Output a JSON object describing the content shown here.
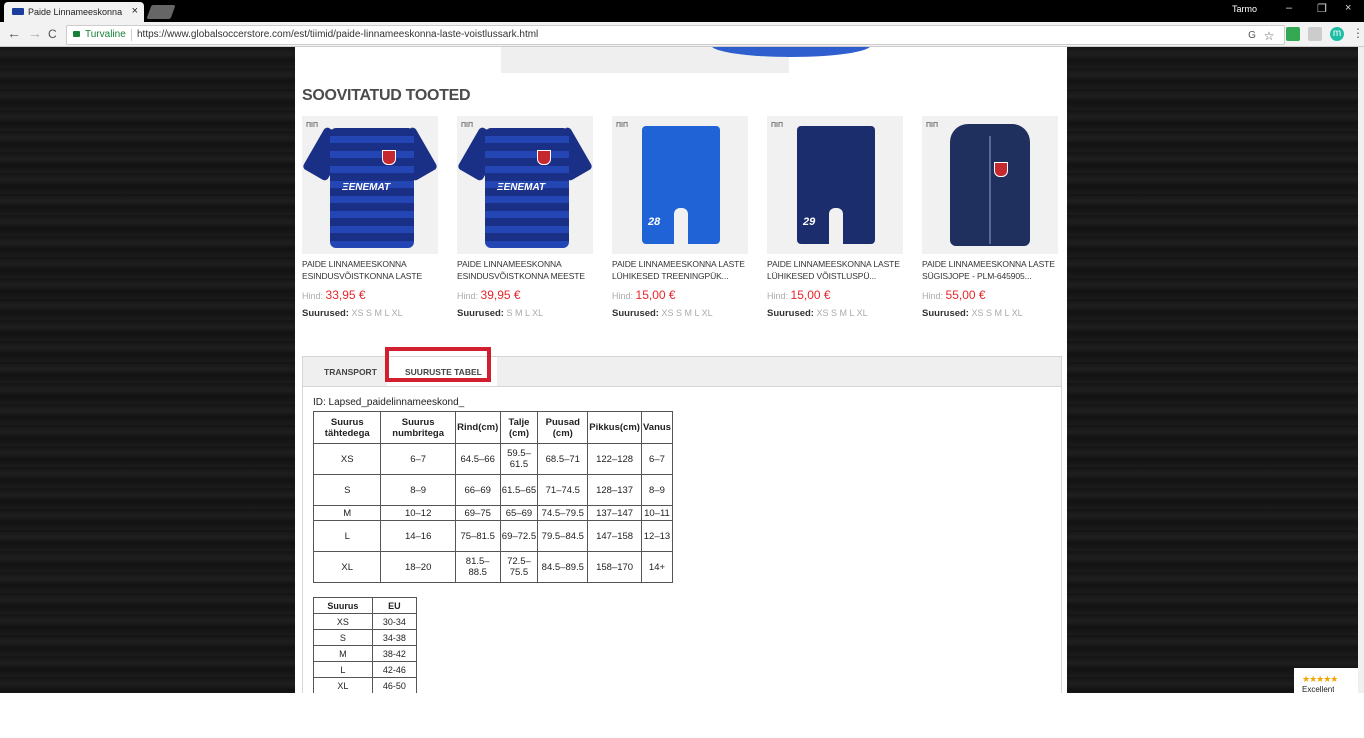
{
  "browser": {
    "tab_title": "Paide Linnameeskonna laste võistlussärk",
    "close_glyph": "×",
    "user_name": "Tarmo",
    "secure_label": "Turvaline",
    "url": "https://www.globalsoccerstore.com/est/tiimid/paide-linnameeskonna-laste-voistlussark.html",
    "back_glyph": "←",
    "forward_glyph": "→",
    "reload_glyph": "C",
    "minimize_glyph": "–",
    "restore_glyph": "❐",
    "close_window_glyph": "×",
    "star_glyph": "☆",
    "menu_glyph": "⋮",
    "translate_glyph": "G",
    "extension_glyph": "m"
  },
  "recommended": {
    "title": "SOOVITATUD TOOTED",
    "price_label": "Hind:",
    "sizes_label": "Suurused:",
    "items": [
      {
        "name": "PAIDE LINNAMEESKONNA ESINDUSVÕISTKONNA LASTE FÄN...",
        "price": "33,95 €",
        "sizes": "XS S M L XL",
        "badge": "ΠΙΠ",
        "image": "jersey"
      },
      {
        "name": "PAIDE LINNAMEESKONNA ESINDUSVÕISTKONNA MEESTE FÄ...",
        "price": "39,95 €",
        "sizes": "S M L XL",
        "badge": "ΠΙΠ",
        "image": "jersey"
      },
      {
        "name": "PAIDE LINNAMEESKONNA LASTE LÜHIKESED TREENINGPÜK...",
        "price": "15,00 €",
        "sizes": "XS S M L XL",
        "badge": "ΠΙΠ",
        "image": "shorts-royal",
        "number": "28"
      },
      {
        "name": "PAIDE LINNAMEESKONNA LASTE LÜHIKESED VÕISTLUSPÜ...",
        "price": "15,00 €",
        "sizes": "XS S M L XL",
        "badge": "ΠΙΠ",
        "image": "shorts-navy",
        "number": "29"
      },
      {
        "name": "PAIDE LINNAMEESKONNA LASTE SÜGISJOPE - PLM-645905...",
        "price": "55,00 €",
        "sizes": "XS S M L XL",
        "badge": "ΠΙΠ",
        "image": "jacket"
      }
    ],
    "jersey_text": "ΞENEMAT"
  },
  "tabs": {
    "transport": "TRANSPORT",
    "size_table": "SUURUSTE TABEL",
    "active": "SUURUSTE TABEL"
  },
  "size_table": {
    "id_line": "ID: Lapsed_paidelinnameeskond_",
    "headers": [
      "Suurus tähtedega",
      "Suurus numbritega",
      "Rind(cm)",
      "Talje (cm)",
      "Puusad (cm)",
      "Pikkus(cm)",
      "Vanus"
    ],
    "rows": [
      [
        "XS",
        "6–7",
        "64.5–66",
        "59.5–61.5",
        "68.5–71",
        "122–128",
        "6–7"
      ],
      [
        "S",
        "8–9",
        "66–69",
        "61.5–65",
        "71–74.5",
        "128–137",
        "8–9"
      ],
      [
        "M",
        "10–12",
        "69–75",
        "65–69",
        "74.5–79.5",
        "137–147",
        "10–11"
      ],
      [
        "L",
        "14–16",
        "75–81.5",
        "69–72.5",
        "79.5–84.5",
        "147–158",
        "12–13"
      ],
      [
        "XL",
        "18–20",
        "81.5–88.5",
        "72.5–75.5",
        "84.5–89.5",
        "158–170",
        "14+"
      ]
    ]
  },
  "eu_table": {
    "headers": [
      "Suurus",
      "EU"
    ],
    "rows": [
      [
        "XS",
        "30-34"
      ],
      [
        "S",
        "34-38"
      ],
      [
        "M",
        "38-42"
      ],
      [
        "L",
        "42-46"
      ],
      [
        "XL",
        "46-50"
      ]
    ]
  },
  "review_widget": {
    "stars": "★★★★★",
    "label": "Excellent"
  },
  "colors": {
    "price": "#e8262c",
    "highlight": "#d21f2f",
    "royal": "#1f63d6",
    "navy": "#1b2d6d"
  }
}
